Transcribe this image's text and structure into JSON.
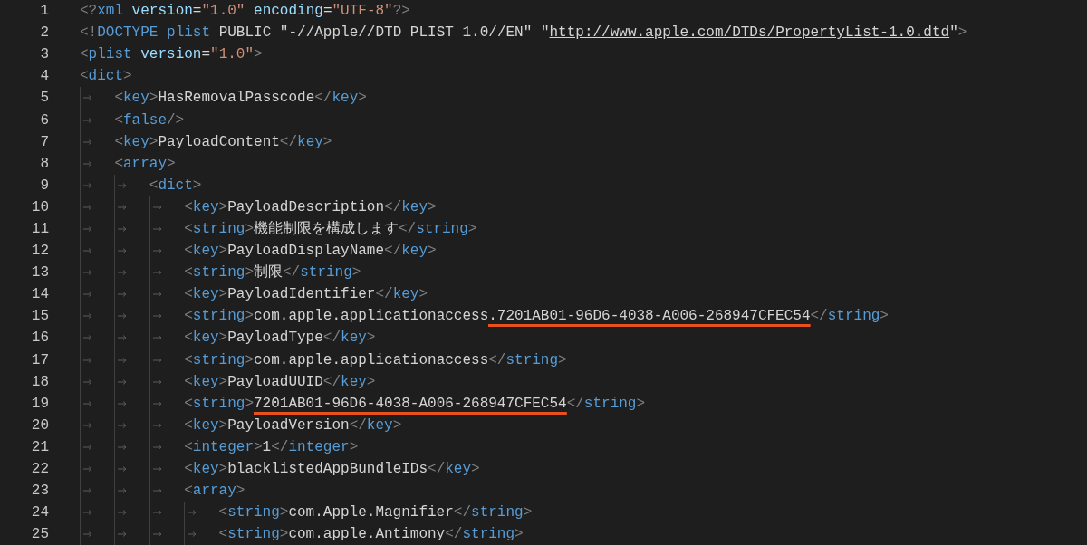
{
  "editor": {
    "lines": [
      {
        "number": "1",
        "tokens": [
          {
            "kind": "punct",
            "text": "<?"
          },
          {
            "kind": "tag",
            "text": "xml"
          },
          {
            "kind": "attr",
            "text": " version"
          },
          {
            "kind": "text",
            "text": "="
          },
          {
            "kind": "value",
            "text": "\"1.0\""
          },
          {
            "kind": "attr",
            "text": " encoding"
          },
          {
            "kind": "text",
            "text": "="
          },
          {
            "kind": "value",
            "text": "\"UTF-8\""
          },
          {
            "kind": "punct",
            "text": "?>"
          }
        ]
      },
      {
        "number": "2",
        "tokens": [
          {
            "kind": "punct",
            "text": "<!"
          },
          {
            "kind": "tag",
            "text": "DOCTYPE"
          },
          {
            "kind": "tag",
            "text": " plist"
          },
          {
            "kind": "text",
            "text": " PUBLIC \"-//Apple//DTD PLIST 1.0//EN\" \""
          },
          {
            "kind": "link",
            "text": "http://www.apple.com/DTDs/PropertyList-1.0.dtd"
          },
          {
            "kind": "text",
            "text": "\""
          },
          {
            "kind": "punct",
            "text": ">"
          }
        ]
      },
      {
        "number": "3",
        "tokens": [
          {
            "kind": "punct",
            "text": "<"
          },
          {
            "kind": "tag",
            "text": "plist"
          },
          {
            "kind": "attr",
            "text": " version"
          },
          {
            "kind": "text",
            "text": "="
          },
          {
            "kind": "value",
            "text": "\"1.0\""
          },
          {
            "kind": "punct",
            "text": ">"
          }
        ]
      },
      {
        "number": "4",
        "tokens": [
          {
            "kind": "punct",
            "text": "<"
          },
          {
            "kind": "tag",
            "text": "dict"
          },
          {
            "kind": "punct",
            "text": ">"
          }
        ],
        "children": [
          {
            "number": "5",
            "tokens": [
              {
                "kind": "punct",
                "text": "<"
              },
              {
                "kind": "tag",
                "text": "key"
              },
              {
                "kind": "punct",
                "text": ">"
              },
              {
                "kind": "text",
                "text": "HasRemovalPasscode"
              },
              {
                "kind": "punct",
                "text": "</"
              },
              {
                "kind": "tag",
                "text": "key"
              },
              {
                "kind": "punct",
                "text": ">"
              }
            ]
          },
          {
            "number": "6",
            "tokens": [
              {
                "kind": "punct",
                "text": "<"
              },
              {
                "kind": "tag",
                "text": "false"
              },
              {
                "kind": "punct",
                "text": "/>"
              }
            ]
          },
          {
            "number": "7",
            "tokens": [
              {
                "kind": "punct",
                "text": "<"
              },
              {
                "kind": "tag",
                "text": "key"
              },
              {
                "kind": "punct",
                "text": ">"
              },
              {
                "kind": "text",
                "text": "PayloadContent"
              },
              {
                "kind": "punct",
                "text": "</"
              },
              {
                "kind": "tag",
                "text": "key"
              },
              {
                "kind": "punct",
                "text": ">"
              }
            ]
          },
          {
            "number": "8",
            "tokens": [
              {
                "kind": "punct",
                "text": "<"
              },
              {
                "kind": "tag",
                "text": "array"
              },
              {
                "kind": "punct",
                "text": ">"
              }
            ],
            "children": [
              {
                "number": "9",
                "tokens": [
                  {
                    "kind": "punct",
                    "text": "<"
                  },
                  {
                    "kind": "tag",
                    "text": "dict"
                  },
                  {
                    "kind": "punct",
                    "text": ">"
                  }
                ],
                "children": [
                  {
                    "number": "10",
                    "tokens": [
                      {
                        "kind": "punct",
                        "text": "<"
                      },
                      {
                        "kind": "tag",
                        "text": "key"
                      },
                      {
                        "kind": "punct",
                        "text": ">"
                      },
                      {
                        "kind": "text",
                        "text": "PayloadDescription"
                      },
                      {
                        "kind": "punct",
                        "text": "</"
                      },
                      {
                        "kind": "tag",
                        "text": "key"
                      },
                      {
                        "kind": "punct",
                        "text": ">"
                      }
                    ]
                  },
                  {
                    "number": "11",
                    "tokens": [
                      {
                        "kind": "punct",
                        "text": "<"
                      },
                      {
                        "kind": "tag",
                        "text": "string"
                      },
                      {
                        "kind": "punct",
                        "text": ">"
                      },
                      {
                        "kind": "text",
                        "text": "機能制限を構成します"
                      },
                      {
                        "kind": "punct",
                        "text": "</"
                      },
                      {
                        "kind": "tag",
                        "text": "string"
                      },
                      {
                        "kind": "punct",
                        "text": ">"
                      }
                    ]
                  },
                  {
                    "number": "12",
                    "tokens": [
                      {
                        "kind": "punct",
                        "text": "<"
                      },
                      {
                        "kind": "tag",
                        "text": "key"
                      },
                      {
                        "kind": "punct",
                        "text": ">"
                      },
                      {
                        "kind": "text",
                        "text": "PayloadDisplayName"
                      },
                      {
                        "kind": "punct",
                        "text": "</"
                      },
                      {
                        "kind": "tag",
                        "text": "key"
                      },
                      {
                        "kind": "punct",
                        "text": ">"
                      }
                    ]
                  },
                  {
                    "number": "13",
                    "tokens": [
                      {
                        "kind": "punct",
                        "text": "<"
                      },
                      {
                        "kind": "tag",
                        "text": "string"
                      },
                      {
                        "kind": "punct",
                        "text": ">"
                      },
                      {
                        "kind": "text",
                        "text": "制限"
                      },
                      {
                        "kind": "punct",
                        "text": "</"
                      },
                      {
                        "kind": "tag",
                        "text": "string"
                      },
                      {
                        "kind": "punct",
                        "text": ">"
                      }
                    ]
                  },
                  {
                    "number": "14",
                    "tokens": [
                      {
                        "kind": "punct",
                        "text": "<"
                      },
                      {
                        "kind": "tag",
                        "text": "key"
                      },
                      {
                        "kind": "punct",
                        "text": ">"
                      },
                      {
                        "kind": "text",
                        "text": "PayloadIdentifier"
                      },
                      {
                        "kind": "punct",
                        "text": "</"
                      },
                      {
                        "kind": "tag",
                        "text": "key"
                      },
                      {
                        "kind": "punct",
                        "text": ">"
                      }
                    ]
                  },
                  {
                    "number": "15",
                    "tokens": [
                      {
                        "kind": "punct",
                        "text": "<"
                      },
                      {
                        "kind": "tag",
                        "text": "string"
                      },
                      {
                        "kind": "punct",
                        "text": ">"
                      },
                      {
                        "kind": "text",
                        "text": "com.apple.applicationaccess"
                      },
                      {
                        "kind": "text",
                        "text": ".7201AB01-96D6-4038-A006-268947CFEC54",
                        "underlined": true
                      },
                      {
                        "kind": "punct",
                        "text": "</"
                      },
                      {
                        "kind": "tag",
                        "text": "string"
                      },
                      {
                        "kind": "punct",
                        "text": ">"
                      }
                    ]
                  },
                  {
                    "number": "16",
                    "tokens": [
                      {
                        "kind": "punct",
                        "text": "<"
                      },
                      {
                        "kind": "tag",
                        "text": "key"
                      },
                      {
                        "kind": "punct",
                        "text": ">"
                      },
                      {
                        "kind": "text",
                        "text": "PayloadType"
                      },
                      {
                        "kind": "punct",
                        "text": "</"
                      },
                      {
                        "kind": "tag",
                        "text": "key"
                      },
                      {
                        "kind": "punct",
                        "text": ">"
                      }
                    ]
                  },
                  {
                    "number": "17",
                    "tokens": [
                      {
                        "kind": "punct",
                        "text": "<"
                      },
                      {
                        "kind": "tag",
                        "text": "string"
                      },
                      {
                        "kind": "punct",
                        "text": ">"
                      },
                      {
                        "kind": "text",
                        "text": "com.apple.applicationaccess"
                      },
                      {
                        "kind": "punct",
                        "text": "</"
                      },
                      {
                        "kind": "tag",
                        "text": "string"
                      },
                      {
                        "kind": "punct",
                        "text": ">"
                      }
                    ]
                  },
                  {
                    "number": "18",
                    "tokens": [
                      {
                        "kind": "punct",
                        "text": "<"
                      },
                      {
                        "kind": "tag",
                        "text": "key"
                      },
                      {
                        "kind": "punct",
                        "text": ">"
                      },
                      {
                        "kind": "text",
                        "text": "PayloadUUID"
                      },
                      {
                        "kind": "punct",
                        "text": "</"
                      },
                      {
                        "kind": "tag",
                        "text": "key"
                      },
                      {
                        "kind": "punct",
                        "text": ">"
                      }
                    ]
                  },
                  {
                    "number": "19",
                    "tokens": [
                      {
                        "kind": "punct",
                        "text": "<"
                      },
                      {
                        "kind": "tag",
                        "text": "string"
                      },
                      {
                        "kind": "punct",
                        "text": ">"
                      },
                      {
                        "kind": "text",
                        "text": "7201AB01-96D6-4038-A006-268947CFEC54",
                        "underlined": true
                      },
                      {
                        "kind": "punct",
                        "text": "</"
                      },
                      {
                        "kind": "tag",
                        "text": "string"
                      },
                      {
                        "kind": "punct",
                        "text": ">"
                      }
                    ]
                  },
                  {
                    "number": "20",
                    "tokens": [
                      {
                        "kind": "punct",
                        "text": "<"
                      },
                      {
                        "kind": "tag",
                        "text": "key"
                      },
                      {
                        "kind": "punct",
                        "text": ">"
                      },
                      {
                        "kind": "text",
                        "text": "PayloadVersion"
                      },
                      {
                        "kind": "punct",
                        "text": "</"
                      },
                      {
                        "kind": "tag",
                        "text": "key"
                      },
                      {
                        "kind": "punct",
                        "text": ">"
                      }
                    ]
                  },
                  {
                    "number": "21",
                    "tokens": [
                      {
                        "kind": "punct",
                        "text": "<"
                      },
                      {
                        "kind": "tag",
                        "text": "integer"
                      },
                      {
                        "kind": "punct",
                        "text": ">"
                      },
                      {
                        "kind": "text",
                        "text": "1"
                      },
                      {
                        "kind": "punct",
                        "text": "</"
                      },
                      {
                        "kind": "tag",
                        "text": "integer"
                      },
                      {
                        "kind": "punct",
                        "text": ">"
                      }
                    ]
                  },
                  {
                    "number": "22",
                    "tokens": [
                      {
                        "kind": "punct",
                        "text": "<"
                      },
                      {
                        "kind": "tag",
                        "text": "key"
                      },
                      {
                        "kind": "punct",
                        "text": ">"
                      },
                      {
                        "kind": "text",
                        "text": "blacklistedAppBundleIDs"
                      },
                      {
                        "kind": "punct",
                        "text": "</"
                      },
                      {
                        "kind": "tag",
                        "text": "key"
                      },
                      {
                        "kind": "punct",
                        "text": ">"
                      }
                    ]
                  },
                  {
                    "number": "23",
                    "tokens": [
                      {
                        "kind": "punct",
                        "text": "<"
                      },
                      {
                        "kind": "tag",
                        "text": "array"
                      },
                      {
                        "kind": "punct",
                        "text": ">"
                      }
                    ],
                    "children": [
                      {
                        "number": "24",
                        "tokens": [
                          {
                            "kind": "punct",
                            "text": "<"
                          },
                          {
                            "kind": "tag",
                            "text": "string"
                          },
                          {
                            "kind": "punct",
                            "text": ">"
                          },
                          {
                            "kind": "text",
                            "text": "com.Apple.Magnifier"
                          },
                          {
                            "kind": "punct",
                            "text": "</"
                          },
                          {
                            "kind": "tag",
                            "text": "string"
                          },
                          {
                            "kind": "punct",
                            "text": ">"
                          }
                        ]
                      },
                      {
                        "number": "25",
                        "tokens": [
                          {
                            "kind": "punct",
                            "text": "<"
                          },
                          {
                            "kind": "tag",
                            "text": "string"
                          },
                          {
                            "kind": "punct",
                            "text": ">"
                          },
                          {
                            "kind": "text",
                            "text": "com.apple.Antimony"
                          },
                          {
                            "kind": "punct",
                            "text": "</"
                          },
                          {
                            "kind": "tag",
                            "text": "string"
                          },
                          {
                            "kind": "punct",
                            "text": ">"
                          }
                        ]
                      }
                    ]
                  }
                ]
              }
            ]
          }
        ]
      }
    ]
  }
}
